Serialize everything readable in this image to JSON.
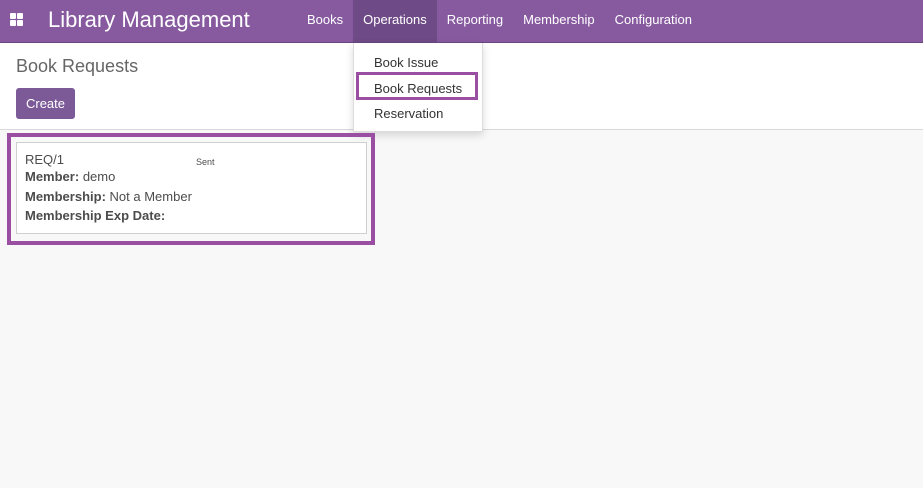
{
  "app": {
    "title": "Library Management"
  },
  "menu": {
    "items": [
      {
        "label": "Books"
      },
      {
        "label": "Operations"
      },
      {
        "label": "Reporting"
      },
      {
        "label": "Membership"
      },
      {
        "label": "Configuration"
      }
    ],
    "active": "Operations"
  },
  "dropdown": {
    "items": [
      {
        "label": "Book Issue"
      },
      {
        "label": "Book Requests"
      },
      {
        "label": "Reservation"
      }
    ],
    "highlighted": "Book Requests"
  },
  "control_panel": {
    "title": "Book Requests",
    "create_label": "Create"
  },
  "records": [
    {
      "reference": "REQ/1",
      "state": "Sent",
      "member_label": "Member:",
      "member": "demo",
      "membership_label": "Membership:",
      "membership": "Not a Member",
      "exp_label": "Membership Exp Date:",
      "exp": ""
    }
  ],
  "colors": {
    "navbar": "#875a9f",
    "active_menu": "#6e4a86",
    "primary_button": "#7c5a98",
    "highlight_box": "#9b4fa3"
  },
  "icons": {
    "apps": "apps-grid-icon"
  }
}
